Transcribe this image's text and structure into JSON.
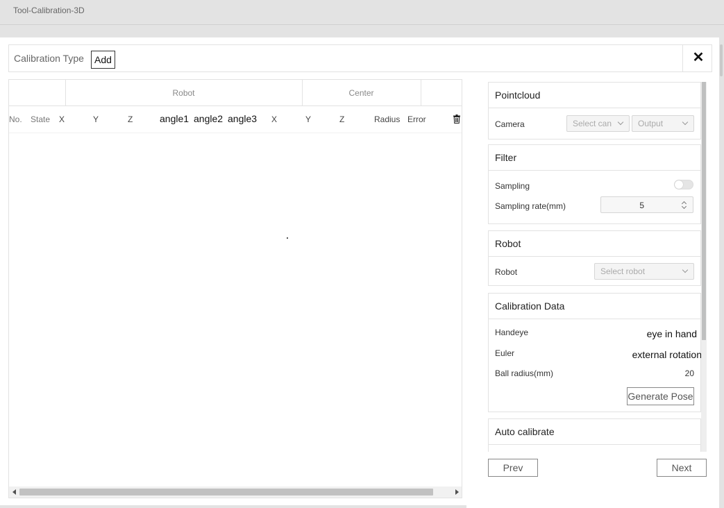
{
  "window": {
    "title": "Tool-Calibration-3D"
  },
  "header": {
    "calibration_type_label": "Calibration Type",
    "add_label": "Add",
    "close_label": "✕"
  },
  "table": {
    "group_headers": [
      "Robot",
      "Center"
    ],
    "columns": [
      "No.",
      "State",
      "X",
      "Y",
      "Z",
      "angle1",
      "angle2",
      "angle3",
      "X",
      "Y",
      "Z",
      "Radius",
      "Error"
    ],
    "rows": []
  },
  "panel": {
    "pointcloud": {
      "title": "Pointcloud",
      "camera_label": "Camera",
      "camera_placeholder": "Select can",
      "output_placeholder": "Output"
    },
    "filter": {
      "title": "Filter",
      "sampling_label": "Sampling",
      "sampling_enabled": false,
      "sampling_rate_label": "Sampling rate(mm)",
      "sampling_rate_value": "5"
    },
    "robot": {
      "title": "Robot",
      "robot_label": "Robot",
      "robot_placeholder": "Select robot"
    },
    "calibration_data": {
      "title": "Calibration Data",
      "handeye_label": "Handeye",
      "handeye_value": "eye in hand",
      "euler_label": "Euler",
      "euler_value": "external rotation",
      "ball_radius_label": "Ball radius(mm)",
      "ball_radius_value": "20",
      "generate_pose_label": "Generate Pose"
    },
    "auto_calibrate": {
      "title": "Auto calibrate"
    }
  },
  "footer": {
    "prev_label": "Prev",
    "next_label": "Next"
  }
}
